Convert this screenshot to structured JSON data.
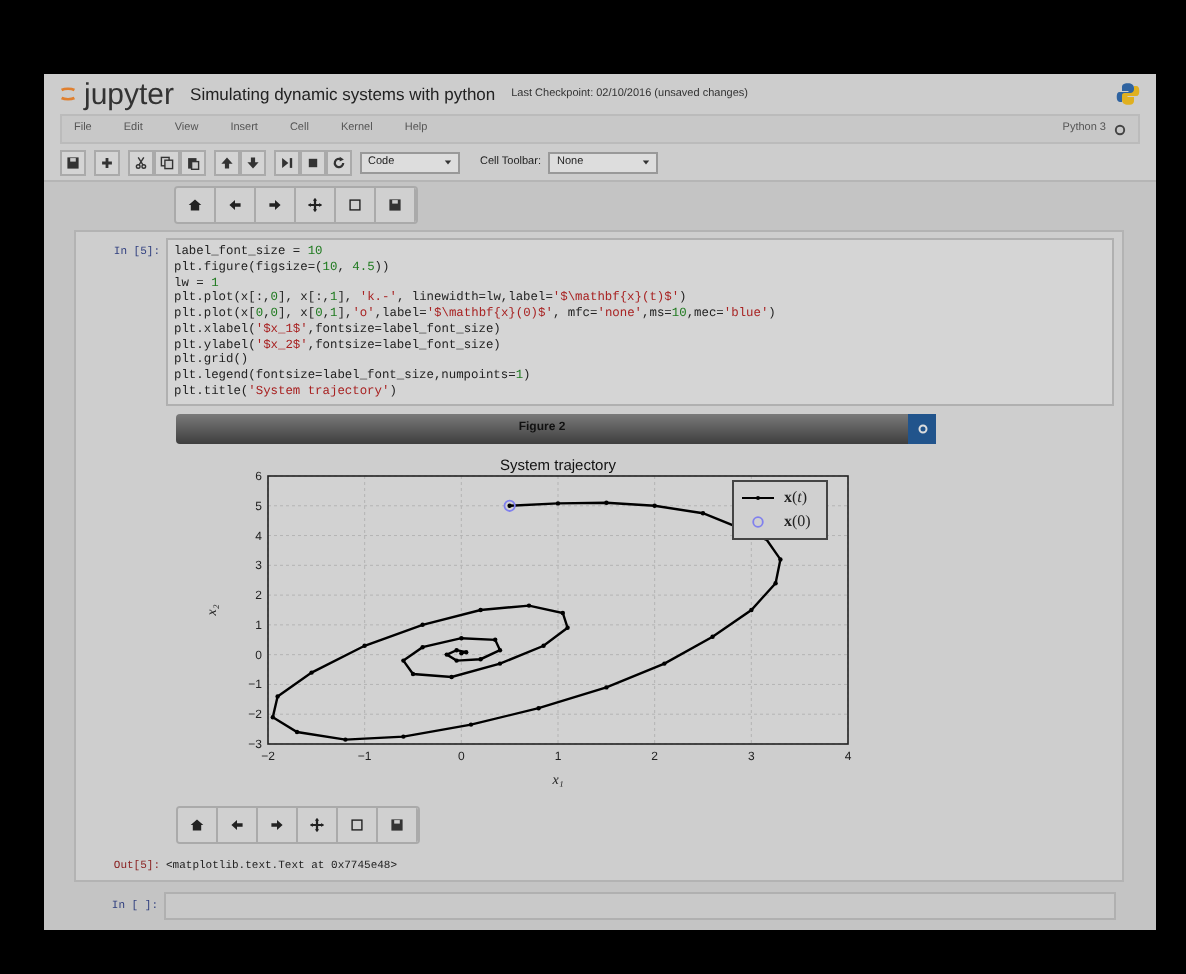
{
  "header": {
    "logo_text": "jupyter",
    "notebook_title": "Simulating dynamic systems with python",
    "checkpoint": "Last Checkpoint: 02/10/2016 (unsaved changes)"
  },
  "menu": [
    "File",
    "Edit",
    "View",
    "Insert",
    "Cell",
    "Kernel",
    "Help"
  ],
  "kernel": {
    "name": "Python 3"
  },
  "toolbar": {
    "cell_type": "Code",
    "cell_toolbar_label": "Cell Toolbar:",
    "cell_toolbar_value": "None"
  },
  "cells": [
    {
      "prompt": "In [5]:",
      "code": [
        "label_font_size = 10",
        "plt.figure(figsize=(10, 4.5))",
        "lw = 1",
        "plt.plot(x[:,0], x[:,1], 'k.-', linewidth=lw,label='$\\mathbf{x}(t)$')",
        "plt.plot(x[0,0], x[0,1],'o',label='$\\mathbf{x}(0)$', mfc='none',ms=10,mec='blue')",
        "plt.xlabel('$x_1$',fontsize=label_font_size)",
        "plt.ylabel('$x_2$',fontsize=label_font_size)",
        "plt.grid()",
        "plt.legend(fontsize=label_font_size,numpoints=1)",
        "plt.title('System trajectory')"
      ],
      "figure": {
        "title": "Figure 2",
        "chart_data": {
          "type": "line",
          "title": "System trajectory",
          "xlabel": "x₁",
          "ylabel": "x₂",
          "xlim": [
            -2,
            4
          ],
          "ylim": [
            -3,
            6
          ],
          "xticks": [
            -2,
            -1,
            0,
            1,
            2,
            3,
            4
          ],
          "yticks": [
            -3,
            -2,
            -1,
            0,
            1,
            2,
            3,
            4,
            5,
            6
          ],
          "grid": true,
          "legend": true,
          "series": [
            {
              "name": "**x**(*t*)",
              "color": "#000000",
              "x": [
                0.5,
                1.0,
                1.5,
                2.0,
                2.5,
                2.9,
                3.15,
                3.3,
                3.25,
                3.0,
                2.6,
                2.1,
                1.5,
                0.8,
                0.1,
                -0.6,
                -1.2,
                -1.7,
                -1.95,
                -1.9,
                -1.55,
                -1.0,
                -0.4,
                0.2,
                0.7,
                1.05,
                1.1,
                0.85,
                0.4,
                -0.1,
                -0.5,
                -0.6,
                -0.4,
                0.0,
                0.35,
                0.4,
                0.2,
                -0.05,
                -0.15,
                -0.05,
                0.05,
                0.0
              ],
              "values": [
                5.0,
                5.08,
                5.1,
                5.0,
                4.75,
                null,
                3.9,
                3.2,
                2.4,
                1.5,
                0.6,
                -0.3,
                -1.1,
                -1.8,
                -2.35,
                -2.75,
                -2.85,
                -2.6,
                -2.1,
                -1.4,
                -0.6,
                0.3,
                1.0,
                1.5,
                1.65,
                1.4,
                0.9,
                0.3,
                -0.3,
                -0.75,
                -0.65,
                -0.2,
                0.25,
                0.55,
                0.5,
                0.15,
                -0.15,
                -0.2,
                0.0,
                0.15,
                0.08,
                0.05
              ]
            },
            {
              "name": "**x**(0)",
              "color": "#8080ee",
              "marker": "circle",
              "x": [
                0.5
              ],
              "values": [
                5.0
              ]
            }
          ]
        }
      },
      "output_prompt": "Out[5]:",
      "output": "<matplotlib.text.Text at 0x7745e48>"
    },
    {
      "prompt": "In [ ]:"
    }
  ]
}
